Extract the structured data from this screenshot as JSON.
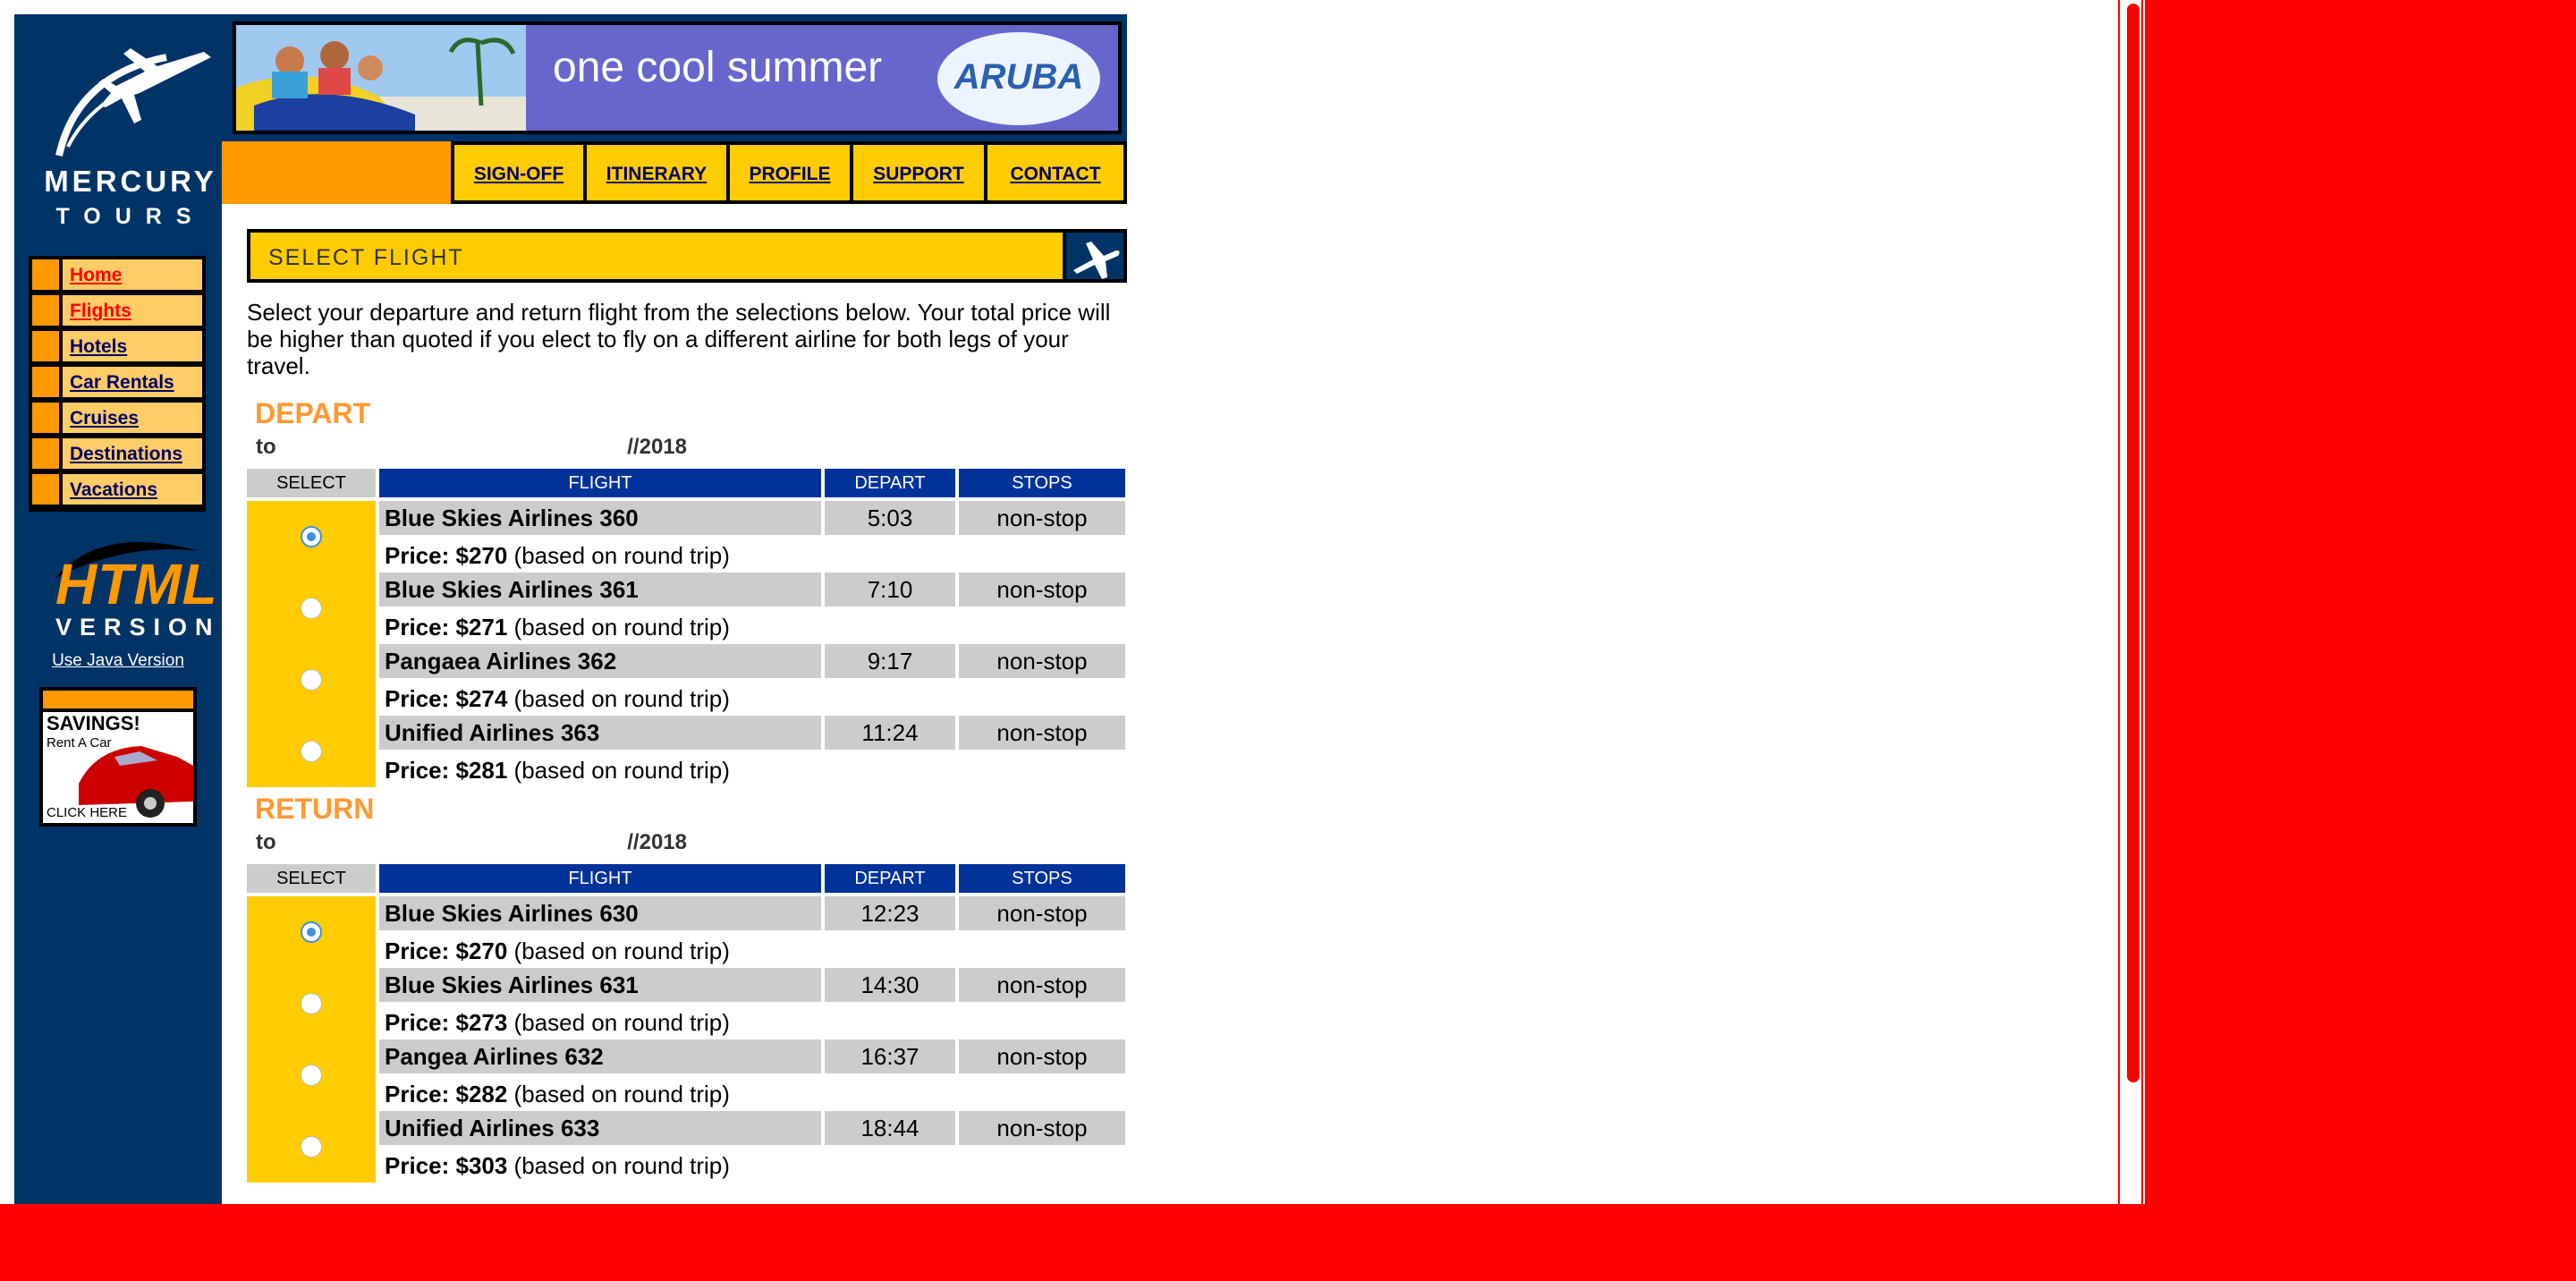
{
  "brand": {
    "line1": "MERCURY",
    "line2": "TOURS"
  },
  "banner": {
    "tagline": "one cool summer",
    "badge": "ARUBA"
  },
  "sidebar": {
    "items": [
      {
        "label": "Home",
        "active": true
      },
      {
        "label": "Flights",
        "active": true
      },
      {
        "label": "Hotels",
        "active": false
      },
      {
        "label": "Car Rentals",
        "active": false
      },
      {
        "label": "Cruises",
        "active": false
      },
      {
        "label": "Destinations",
        "active": false
      },
      {
        "label": "Vacations",
        "active": false
      }
    ],
    "html_version": {
      "line1": "HTML",
      "line2": "VERSION"
    },
    "java_link": "Use Java Version",
    "ad": {
      "line1": "SAVINGS!",
      "line2": "Rent A Car",
      "line3": "CLICK HERE"
    }
  },
  "topnav": {
    "items": [
      "SIGN-OFF",
      "ITINERARY",
      "PROFILE",
      "SUPPORT",
      "CONTACT"
    ]
  },
  "heading": "SELECT FLIGHT",
  "intro": "Select your departure and return flight from the selections below. Your total price will be higher than quoted if you elect to fly on a different airline for both legs of your travel.",
  "columns": {
    "select": "SELECT",
    "flight": "FLIGHT",
    "depart": "DEPART",
    "stops": "STOPS"
  },
  "depart": {
    "title": "DEPART",
    "route": "to",
    "date": "//2018",
    "flights": [
      {
        "name": "Blue Skies Airlines 360",
        "time": "5:03",
        "stops": "non-stop",
        "price_label": "Price: $270",
        "price_note": " (based on round trip)",
        "selected": true
      },
      {
        "name": "Blue Skies Airlines 361",
        "time": "7:10",
        "stops": "non-stop",
        "price_label": "Price: $271",
        "price_note": " (based on round trip)",
        "selected": false
      },
      {
        "name": "Pangaea Airlines 362",
        "time": "9:17",
        "stops": "non-stop",
        "price_label": "Price: $274",
        "price_note": " (based on round trip)",
        "selected": false
      },
      {
        "name": "Unified Airlines 363",
        "time": "11:24",
        "stops": "non-stop",
        "price_label": "Price: $281",
        "price_note": " (based on round trip)",
        "selected": false
      }
    ]
  },
  "return": {
    "title": "RETURN",
    "route": "to",
    "date": "//2018",
    "flights": [
      {
        "name": "Blue Skies Airlines 630",
        "time": "12:23",
        "stops": "non-stop",
        "price_label": "Price: $270",
        "price_note": " (based on round trip)",
        "selected": true
      },
      {
        "name": "Blue Skies Airlines 631",
        "time": "14:30",
        "stops": "non-stop",
        "price_label": "Price: $273",
        "price_note": " (based on round trip)",
        "selected": false
      },
      {
        "name": "Pangea Airlines 632",
        "time": "16:37",
        "stops": "non-stop",
        "price_label": "Price: $282",
        "price_note": " (based on round trip)",
        "selected": false
      },
      {
        "name": "Unified Airlines 633",
        "time": "18:44",
        "stops": "non-stop",
        "price_label": "Price: $303",
        "price_note": " (based on round trip)",
        "selected": false
      }
    ]
  },
  "colors": {
    "navy": "#003366",
    "nav_blue": "#003399",
    "yellow": "#ffcc00",
    "orange": "#ff9900",
    "background_red": "#ff0000"
  }
}
